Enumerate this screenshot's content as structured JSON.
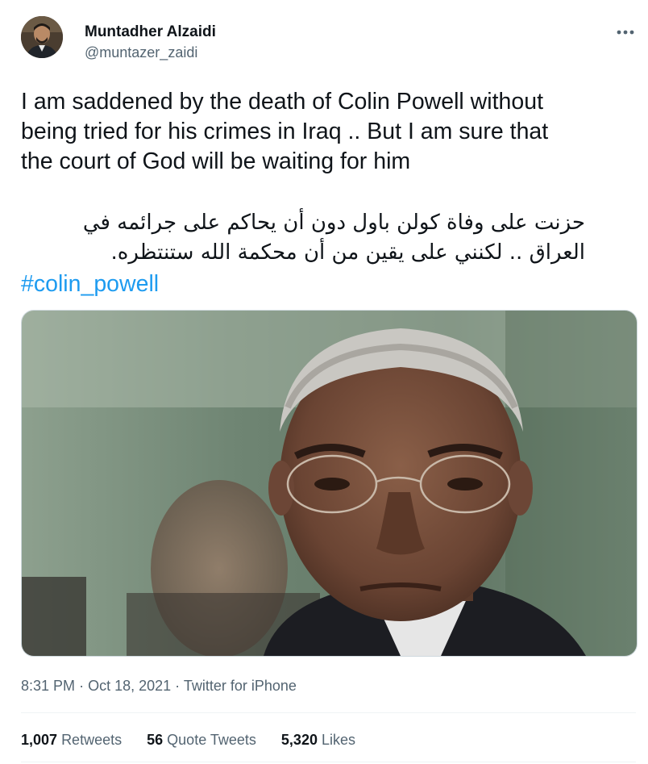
{
  "author": {
    "name": "Muntadher Alzaidi",
    "handle": "@muntazer_zaidi"
  },
  "tweet": {
    "text_lines": [
      "I am saddened by the death of Colin Powell without",
      "being tried for his crimes in Iraq .. But I am sure that",
      "the court of God will be waiting for him"
    ],
    "arabic_lines": [
      "حزنت على وفاة كولن باول دون أن يحاكم على جرائمه في",
      "العراق .. لكنني على يقين من أن محكمة الله ستنتظره."
    ],
    "hashtag": "#colin_powell"
  },
  "meta": {
    "time": "8:31 PM",
    "date": "Oct 18, 2021",
    "source": "Twitter for iPhone",
    "separator": "·"
  },
  "stats": [
    {
      "value": "1,007",
      "label": "Retweets"
    },
    {
      "value": "56",
      "label": "Quote Tweets"
    },
    {
      "value": "5,320",
      "label": "Likes"
    }
  ],
  "icons": {
    "more": "more-horizontal-icon"
  },
  "colors": {
    "text": "#0f1419",
    "secondary": "#536471",
    "link": "#1d9bf0",
    "divider": "#eff3f4"
  }
}
